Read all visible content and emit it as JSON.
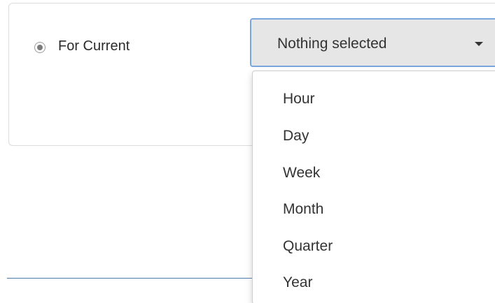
{
  "filter": {
    "radio_label": "For Current",
    "select": {
      "selected_text": "Nothing selected",
      "options": [
        {
          "label": "Hour"
        },
        {
          "label": "Day"
        },
        {
          "label": "Week"
        },
        {
          "label": "Month"
        },
        {
          "label": "Quarter"
        },
        {
          "label": "Year"
        }
      ]
    }
  },
  "colors": {
    "select_border": "#78a6dd",
    "select_bg": "#e6e6e6",
    "divider": "#4a78a8"
  },
  "icons": {
    "radio": "radio-selected-icon",
    "caret": "caret-down-icon"
  }
}
